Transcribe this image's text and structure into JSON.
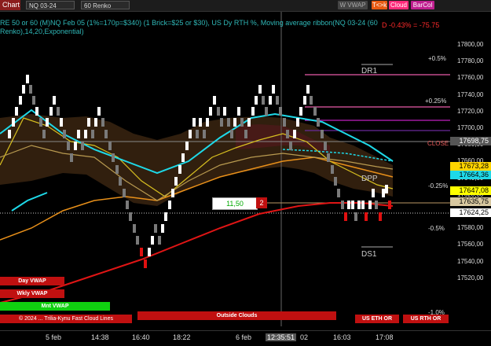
{
  "toolbar": {
    "chart_tab": "Chart",
    "instrument": "NQ 03-24",
    "bar_type": "60 Renko",
    "btn_wvwap": "W VWAP",
    "btn_tk": "T<>k",
    "btn_cloud": "Cloud",
    "btn_barcol": "BarCol"
  },
  "indicator_description": "RE 50 or 60 (M)NQ Feb 05 (1%=170p=$340) (1 Brick=$25 or $30), US Dy RTH %, Moving average ribbon(NQ 03-24 (60 Renko),14,20,Exponential)",
  "pnl_text": "D -0.43% = -75.75",
  "price_axis": {
    "ticks": [
      "17800,00",
      "17780,00",
      "17760,00",
      "17740,00",
      "17720,00",
      "17700,00",
      "17680,00",
      "17660,00",
      "17640,00",
      "17620,00",
      "17600,00",
      "17580,00",
      "17560,00",
      "17540,00",
      "17520,00"
    ],
    "percent_marks": [
      "+0.5%",
      "+0.25%",
      "CLOSE",
      "-0.25%",
      "-0.5%",
      "-1.0%"
    ]
  },
  "price_flags": {
    "close": "17698,75",
    "ma1": "17673,28",
    "ma2": "17664,36",
    "current": "17647,08",
    "level1": "17635,75",
    "level2": "17624,25"
  },
  "pivot_labels": {
    "dr1": "DR1",
    "dpp": "DPP",
    "ds1": "DS1"
  },
  "order_box": {
    "qty": "11,50",
    "num": "2"
  },
  "vwap_labels": {
    "day": "Day VWAP",
    "wkly": "Wkly VWAP",
    "mnt": "Mnt VWAP",
    "timeseries": "© 2024 ... Trilia-Kynu Fast Cloud Lines"
  },
  "bottom_bars": {
    "outside": "Outside Clouds",
    "eth": "US ETH OR",
    "rth": "US RTH OR"
  },
  "time_axis": [
    "5 feb",
    "14:38",
    "16:40",
    "18:22",
    "6 feb",
    "12:35:51",
    "02",
    "16:03",
    "17:08"
  ],
  "colors": {
    "up_brick": "#ffffff",
    "down_brick": "#7a7a7a",
    "red_brick": "#e01010",
    "cloud": "#3a2410",
    "cyan": "#1ed9e8",
    "flag_yellow": "#ffff00",
    "flag_current": "#ffff00"
  }
}
